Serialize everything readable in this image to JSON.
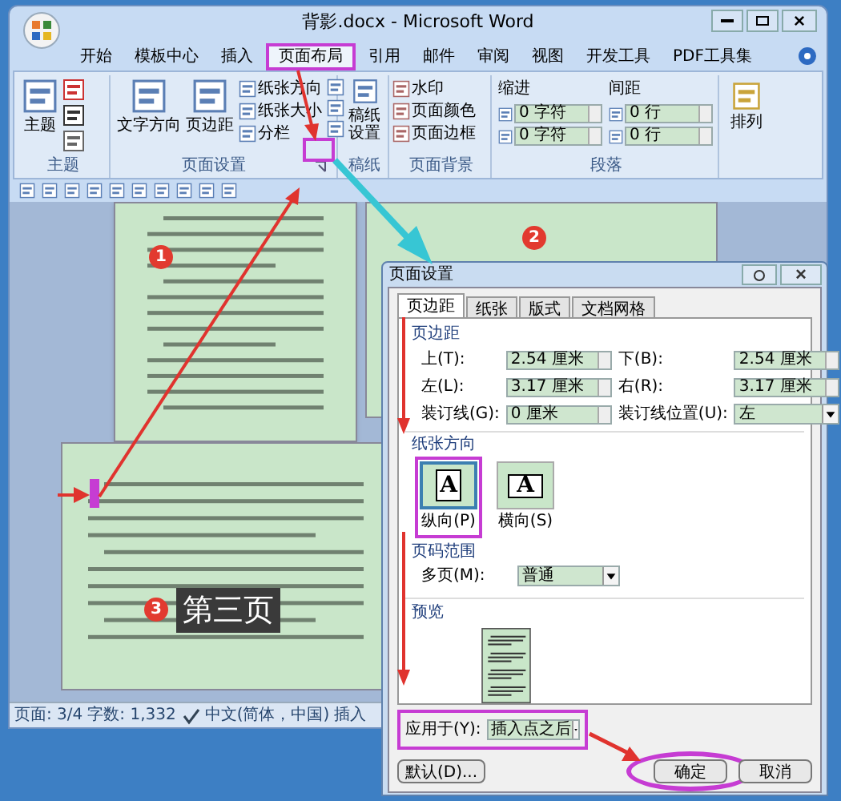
{
  "window": {
    "title": "背影.docx - Microsoft Word"
  },
  "ribbon_tabs": [
    {
      "label": "开始",
      "selected": false
    },
    {
      "label": "模板中心",
      "selected": false
    },
    {
      "label": "插入",
      "selected": false
    },
    {
      "label": "页面布局",
      "selected": true
    },
    {
      "label": "引用",
      "selected": false
    },
    {
      "label": "邮件",
      "selected": false
    },
    {
      "label": "审阅",
      "selected": false
    },
    {
      "label": "视图",
      "selected": false
    },
    {
      "label": "开发工具",
      "selected": false
    },
    {
      "label": "PDF工具集",
      "selected": false
    }
  ],
  "ribbon": {
    "theme_group": {
      "label": "主题",
      "button": "主题"
    },
    "page_setup_group": {
      "label": "页面设置",
      "big_buttons": [
        "文字方向",
        "页边距"
      ],
      "small_buttons": [
        "纸张方向",
        "纸张大小",
        "分栏"
      ]
    },
    "draft_group": {
      "label": "稿纸",
      "button": "稿纸设置"
    },
    "background_group": {
      "label": "页面背景",
      "buttons": [
        "水印",
        "页面颜色",
        "页面边框"
      ]
    },
    "paragraph_group": {
      "label": "段落",
      "indent_label": "缩进",
      "spacing_label": "间距",
      "indent_fields": [
        "0 字符",
        "0 字符"
      ],
      "spacing_fields": [
        "0 行",
        "0 行"
      ]
    },
    "arrange_group": {
      "button": "排列"
    }
  },
  "status_bar": [
    {
      "kind": "text",
      "text": "页面: 3/4"
    },
    {
      "kind": "text",
      "text": "字数: 1,332"
    },
    {
      "kind": "proofing_icon"
    },
    {
      "kind": "text",
      "text": "中文(简体，中国)"
    },
    {
      "kind": "text",
      "text": "插入"
    }
  ],
  "dialog": {
    "title": "页面设置",
    "tabs": [
      {
        "label": "页边距",
        "selected": true
      },
      {
        "label": "纸张",
        "selected": false
      },
      {
        "label": "版式",
        "selected": false
      },
      {
        "label": "文档网格",
        "selected": false
      }
    ],
    "margins_heading": "页边距",
    "margin_fields": [
      {
        "label": "上(T):",
        "value": "2.54 厘米",
        "kind": "spin"
      },
      {
        "label": "下(B):",
        "value": "2.54 厘米",
        "kind": "spin"
      },
      {
        "label": "左(L):",
        "value": "3.17 厘米",
        "kind": "spin"
      },
      {
        "label": "右(R):",
        "value": "3.17 厘米",
        "kind": "spin"
      },
      {
        "label": "装订线(G):",
        "value": "0 厘米",
        "kind": "spin"
      },
      {
        "label": "装订线位置(U):",
        "value": "左",
        "kind": "dropdown"
      }
    ],
    "orientation_heading": "纸张方向",
    "orientations": [
      {
        "label": "纵向(P)",
        "glyph": "A",
        "selected": true
      },
      {
        "label": "横向(S)",
        "glyph": "A",
        "selected": false
      }
    ],
    "pages_heading": "页码范围",
    "multiple_pages": {
      "label": "多页(M):",
      "value": "普通"
    },
    "preview_heading": "预览",
    "apply_to": {
      "label": "应用于(Y):",
      "value": "插入点之后"
    },
    "buttons": [
      {
        "label": "默认(D)...",
        "kind": "default"
      },
      {
        "label": "确定",
        "kind": "ok"
      },
      {
        "label": "取消",
        "kind": "cancel"
      }
    ]
  },
  "annotations": {
    "markers": [
      "1",
      "2",
      "3"
    ],
    "callout": "第三页"
  }
}
